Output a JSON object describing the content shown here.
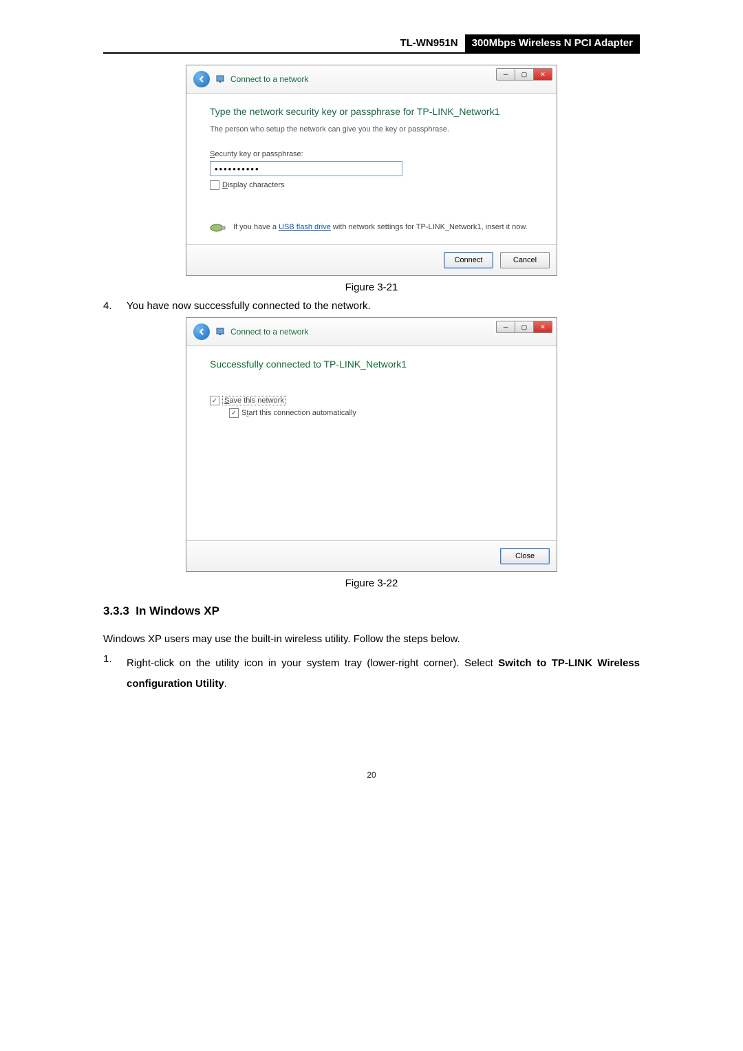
{
  "header": {
    "model": "TL-WN951N",
    "product": "300Mbps Wireless N PCI Adapter"
  },
  "dialog1": {
    "window_title": "Connect to a network",
    "heading": "Type the network security key or passphrase for TP-LINK_Network1",
    "subtext": "The person who setup the network can give you the key or passphrase.",
    "field_label": "Security key or passphrase:",
    "field_value": "••••••••••",
    "display_chars_label": "Display characters",
    "usb_text_pre": "If you have a ",
    "usb_link": "USB flash drive",
    "usb_text_post": " with network settings for TP-LINK_Network1, insert it now.",
    "btn_connect": "Connect",
    "btn_cancel": "Cancel"
  },
  "figure1_label": "Figure 3-21",
  "step4": {
    "num": "4.",
    "text": "You have now successfully connected to the network."
  },
  "dialog2": {
    "window_title": "Connect to a network",
    "heading": "Successfully connected to TP-LINK_Network1",
    "save_label": "Save this network",
    "auto_label": "Start this connection automatically",
    "btn_close": "Close"
  },
  "figure2_label": "Figure 3-22",
  "section": {
    "num": "3.3.3",
    "title": "In Windows XP"
  },
  "xp_intro": "Windows XP users may use the built-in wireless utility. Follow the steps below.",
  "xp_step1": {
    "num": "1.",
    "text_a": "Right-click on the utility icon in your system tray (lower-right corner). Select ",
    "bold_a": "Switch to TP-LINK Wireless configuration Utility",
    "text_b": "."
  },
  "page_number": "20"
}
